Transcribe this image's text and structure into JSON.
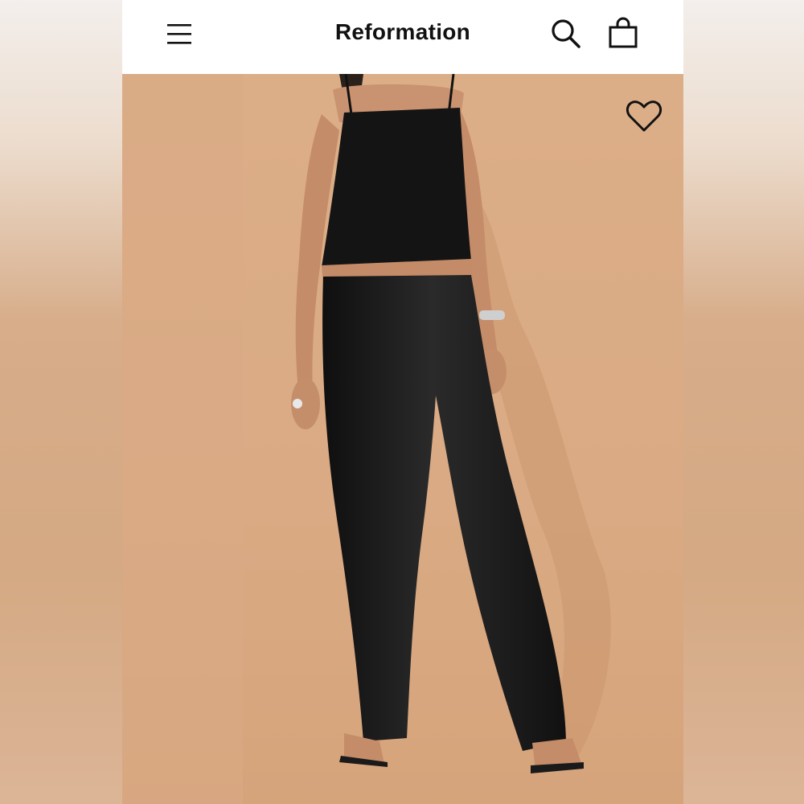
{
  "header": {
    "brand": "Reformation",
    "icons": {
      "menu": "menu-icon",
      "search": "search-icon",
      "bag": "shopping-bag-icon"
    }
  },
  "product_image": {
    "wishlist_icon": "heart-icon",
    "subject": "model-wearing-black-crochet-cami-and-black-satin-pants"
  },
  "colors": {
    "backdrop": "#dcae88",
    "garment": "#141414",
    "header_bg": "#ffffff"
  }
}
